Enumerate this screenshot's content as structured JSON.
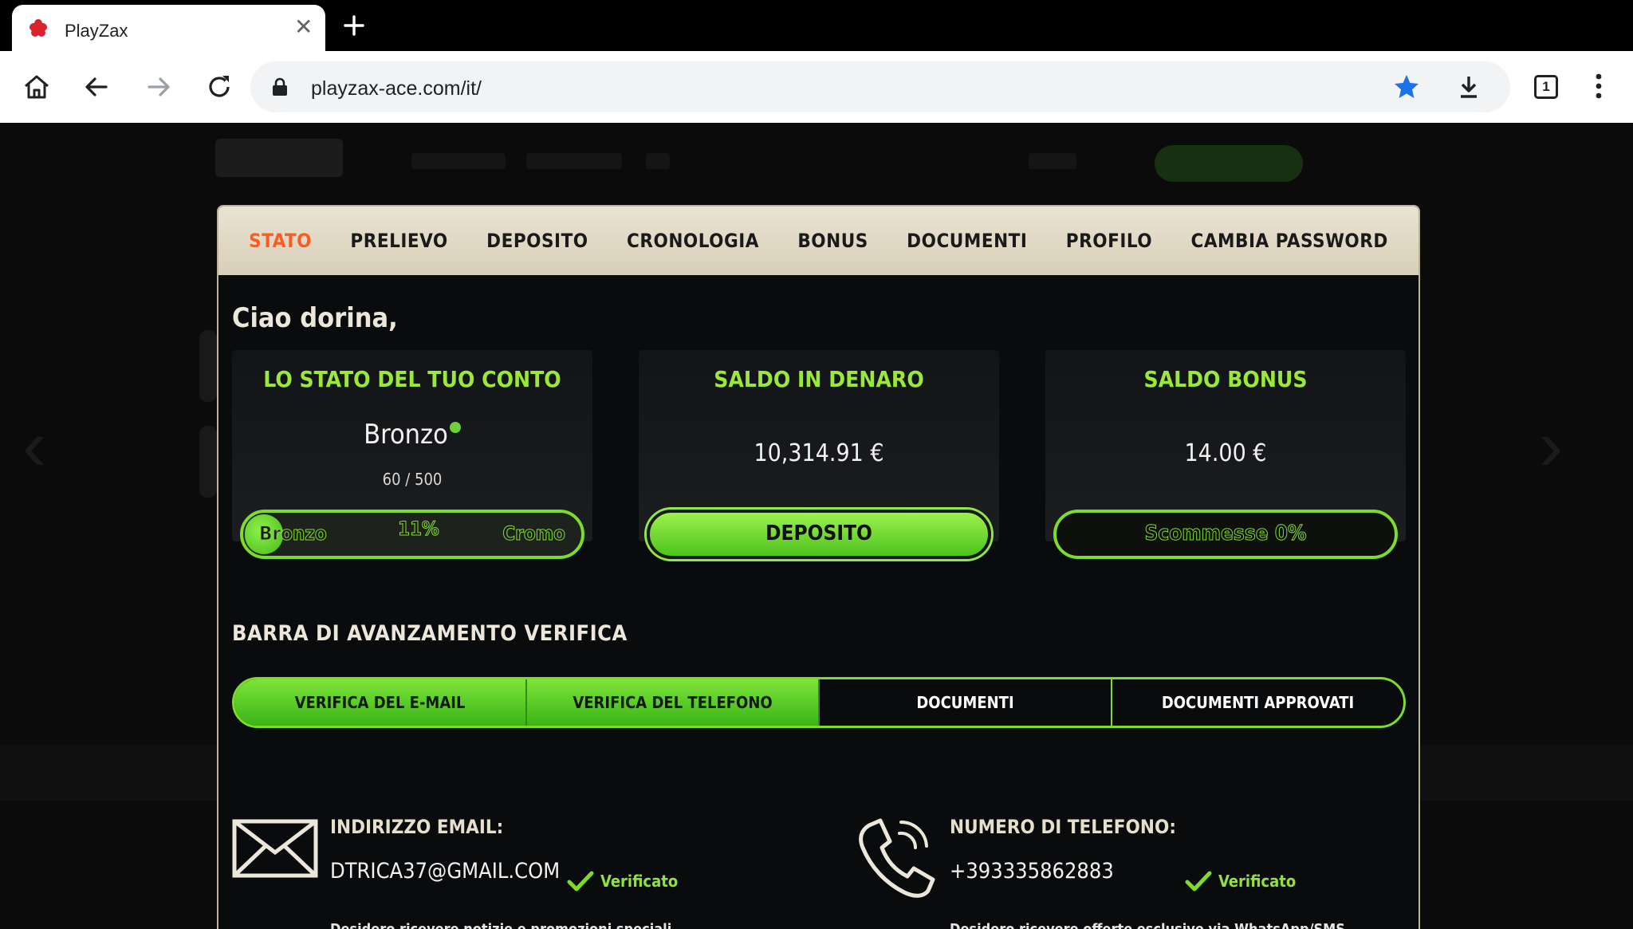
{
  "browser": {
    "tab_title": "PlayZax",
    "url": "playzax-ace.com/it/",
    "tab_count": "1"
  },
  "nav": {
    "items": [
      "STATO",
      "PRELIEVO",
      "DEPOSITO",
      "CRONOLOGIA",
      "BONUS",
      "DOCUMENTI",
      "PROFILO",
      "CAMBIA PASSWORD"
    ],
    "active": "STATO"
  },
  "greeting": "Ciao dorina,",
  "account_status": {
    "title": "LO STATO DEL TUO CONTO",
    "tier": "Bronzo",
    "points": "60 / 500",
    "progress_from": "Bronzo",
    "progress_percent": "11%",
    "progress_to": "Cromo",
    "progress_fraction": 0.11
  },
  "cash_balance": {
    "title": "SALDO IN DENARO",
    "amount": "10,314.91 €",
    "deposit_button": "DEPOSITO"
  },
  "bonus_balance": {
    "title": "SALDO BONUS",
    "amount": "14.00 €",
    "wagering": "Scommesse  0%"
  },
  "verification": {
    "title": "BARRA DI AVANZAMENTO VERIFICA",
    "steps": [
      {
        "label": "VERIFICA DEL E-MAIL",
        "done": true
      },
      {
        "label": "VERIFICA DEL TELEFONO",
        "done": true
      },
      {
        "label": "DOCUMENTI",
        "done": false
      },
      {
        "label": "DOCUMENTI APPROVATI",
        "done": false
      }
    ]
  },
  "email": {
    "label": "INDIRIZZO EMAIL:",
    "value": "DTRICA37@GMAIL.COM",
    "status": "Verificato",
    "note": "Desidero ricevere notizie e promozioni speciali"
  },
  "phone": {
    "label": "NUMERO DI TELEFONO:",
    "value": "+393335862883",
    "status": "Verificato",
    "note": "Desidero ricevere offerte esclusive via WhatsApp/SMS"
  },
  "colors": {
    "accent_green": "#7ddc2a",
    "active_tab": "#ff5a1f",
    "nav_bg": "#e2dbc6",
    "panel_bg": "#0a0b0d"
  }
}
